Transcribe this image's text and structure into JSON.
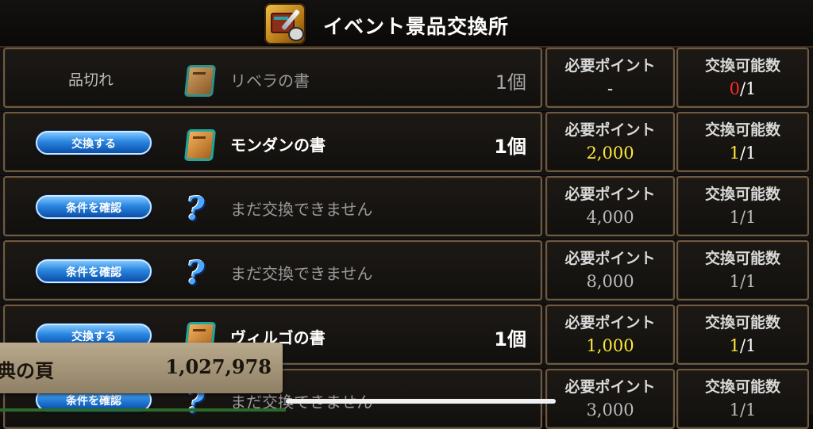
{
  "header": {
    "title": "イベント景品交換所"
  },
  "columns": {
    "points_label": "必要ポイント",
    "count_label": "交換可能数"
  },
  "rows": [
    {
      "status_text": "品切れ",
      "button": "",
      "icon": "book-icon",
      "name": "リベラの書",
      "qty": "1個",
      "points": "-",
      "count_used": "0",
      "count_total": "/1",
      "state": "soldout"
    },
    {
      "status_text": "",
      "button": "交換する",
      "icon": "book-icon",
      "name": "モンダンの書",
      "qty": "1個",
      "points": "2,000",
      "count_used": "1",
      "count_total": "/1",
      "state": "available"
    },
    {
      "status_text": "",
      "button": "条件を確認",
      "icon": "question-icon",
      "name": "まだ交換できません",
      "qty": "",
      "points": "4,000",
      "count_used": "1",
      "count_total": "/1",
      "state": "locked"
    },
    {
      "status_text": "",
      "button": "条件を確認",
      "icon": "question-icon",
      "name": "まだ交換できません",
      "qty": "",
      "points": "8,000",
      "count_used": "1",
      "count_total": "/1",
      "state": "locked"
    },
    {
      "status_text": "",
      "button": "交換する",
      "icon": "book-icon",
      "name": "ヴィルゴの書",
      "qty": "1個",
      "points": "1,000",
      "count_used": "1",
      "count_total": "/1",
      "state": "available"
    },
    {
      "status_text": "",
      "button": "条件を確認",
      "icon": "question-icon",
      "name": "まだ交換できません",
      "qty": "",
      "points": "3,000",
      "count_used": "1",
      "count_total": "/1",
      "state": "locked"
    }
  ],
  "currency": {
    "label": "典の頁",
    "amount": "1,027,978"
  },
  "colors": {
    "accent_yellow": "#ffe83a",
    "soldout_red": "#ff2a2a",
    "button_blue": "#2a86e0"
  }
}
